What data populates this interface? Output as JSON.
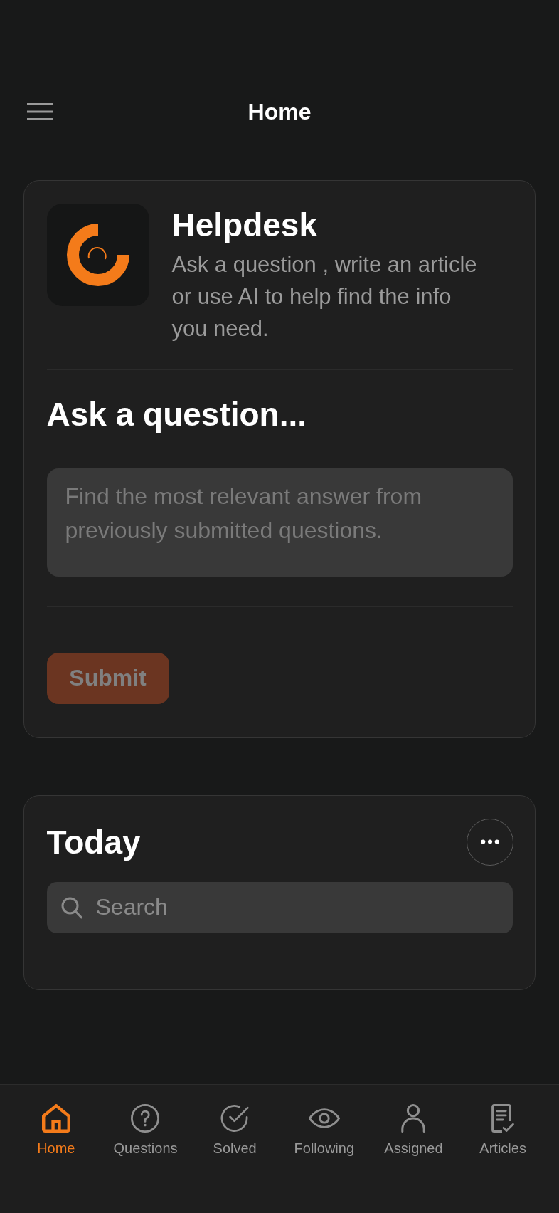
{
  "header": {
    "title": "Home"
  },
  "intro": {
    "title": "Helpdesk",
    "description": "Ask a question , write an article or use AI to help find the info you need."
  },
  "ask": {
    "heading": "Ask a question...",
    "question_field": {
      "placeholder": "Find the most relevant answer from previously submitted questions."
    },
    "submit": {
      "label": "Submit",
      "disabled": true
    }
  },
  "today": {
    "title": "Today",
    "search": {
      "placeholder": "Search"
    }
  },
  "bottom_nav": [
    {
      "label": "Home",
      "kind": "home",
      "selected": true
    },
    {
      "label": "Questions",
      "kind": "question",
      "selected": false
    },
    {
      "label": "Solved",
      "kind": "solved",
      "selected": false
    },
    {
      "label": "Following",
      "kind": "following",
      "selected": false
    },
    {
      "label": "Assigned",
      "kind": "assigned",
      "selected": false
    },
    {
      "label": "Articles",
      "kind": "articles",
      "selected": false
    }
  ]
}
